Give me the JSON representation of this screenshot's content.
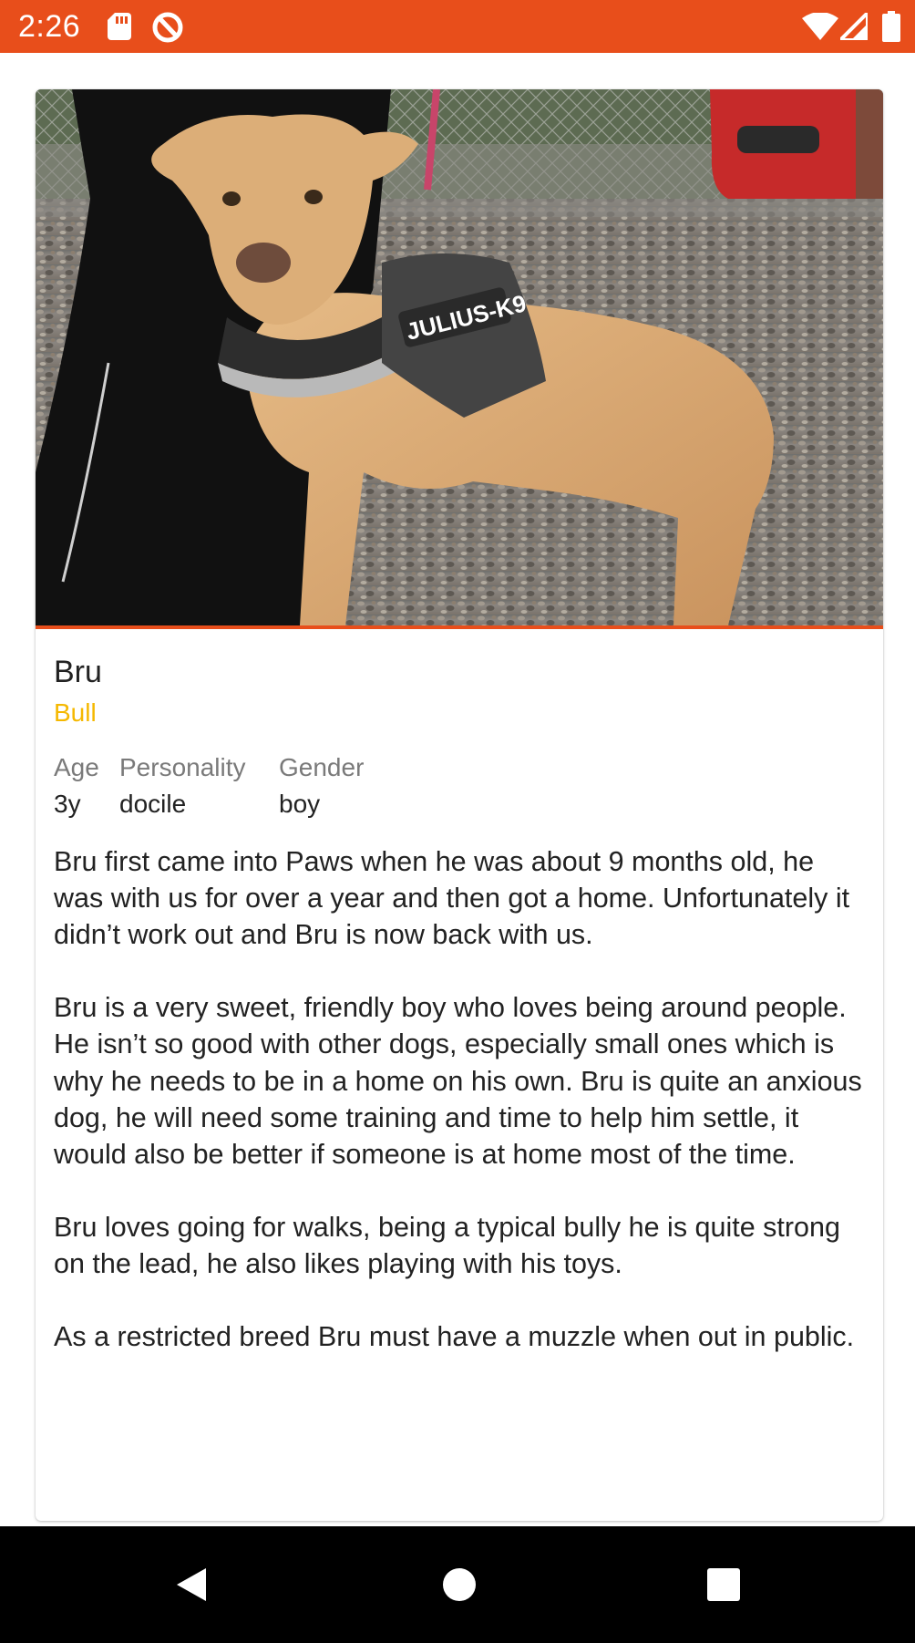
{
  "status_bar": {
    "time": "2:26",
    "background_color": "#e84e1b",
    "left_icons": [
      "sd-card-icon",
      "data-saver-icon"
    ],
    "right_icons": [
      "wifi-icon",
      "cellular-signal-icon",
      "battery-icon"
    ]
  },
  "pet": {
    "photo_icon": "dog-photo",
    "photo_harness_text": "JULIUS-K9",
    "accent_color": "#e84e1b",
    "name": "Bru",
    "breed": "Bull",
    "breed_color": "#f5b800",
    "attributes": [
      {
        "label": "Age",
        "value": "3y"
      },
      {
        "label": "Personality",
        "value": "docile"
      },
      {
        "label": "Gender",
        "value": "boy"
      }
    ],
    "description": "Bru first came into Paws when he was about 9 months old, he was with us for over a year and then got a home. Unfortunately it didn’t work out and Bru is now back with us.\n\nBru is a very sweet, friendly boy who loves being around people. He isn’t so good with other dogs, especially small ones which is why he needs to be in a home on his own. Bru is quite an anxious dog, he will need some training and time to help him settle, it would also be better if someone is at home most of the time.\n\nBru loves going for walks, being a typical bully he is quite strong on the lead, he also likes playing with his toys.\n\nAs a restricted breed Bru must have a muzzle when out in public."
  },
  "nav_bar": {
    "buttons": [
      {
        "name": "back",
        "icon": "triangle-back-icon"
      },
      {
        "name": "home",
        "icon": "circle-home-icon"
      },
      {
        "name": "recents",
        "icon": "square-recents-icon"
      }
    ]
  }
}
